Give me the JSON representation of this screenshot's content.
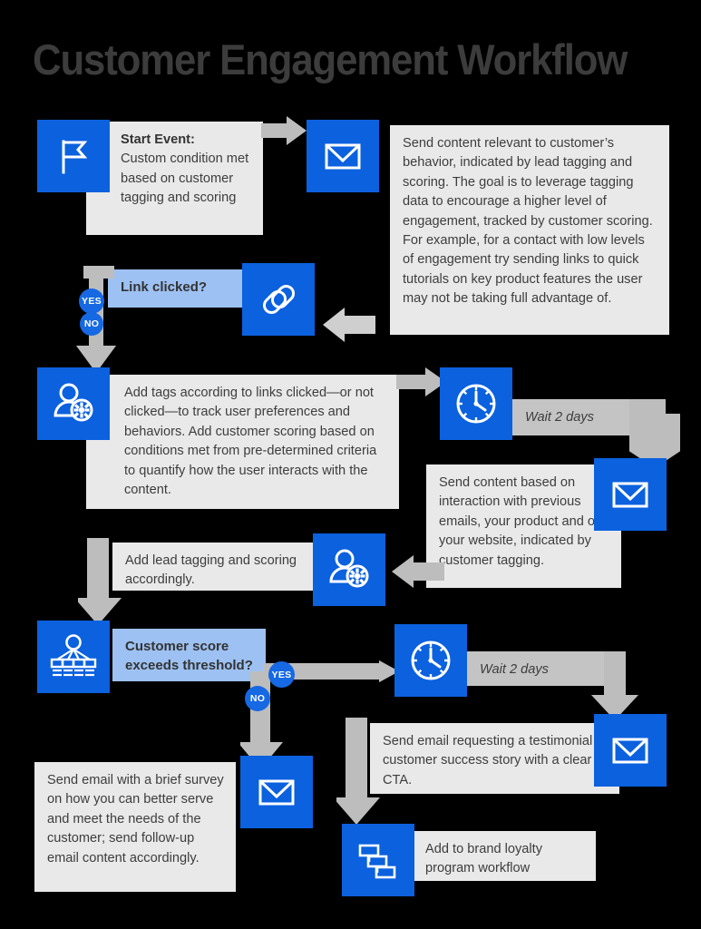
{
  "title": "Customer Engagement Workflow",
  "colors": {
    "background": "#000000",
    "icon_blue": "#0b61de",
    "decision_blue": "#9dc1f2",
    "text_gray": "#e9e9e9",
    "wait_gray": "#c4c4c4",
    "arrow_gray": "#bdbdbd",
    "badge_blue": "#1668e3",
    "title_gray": "#3c3c3c"
  },
  "badges": {
    "yes": "YES",
    "no": "NO"
  },
  "nodes": {
    "start_event": {
      "icon": "flag-icon",
      "heading": "Start Event:",
      "body": "Custom condition met based on customer tagging and scoring"
    },
    "send_content_behavior": {
      "icon": "envelope-icon",
      "body": "Send content relevant to customer’s behavior, indicated by lead tagging and scoring. The goal is to leverage tagging data to encourage a higher level of engagement, tracked by customer scoring. For example, for a contact with low levels of engagement try sending links to quick tutorials on key product features the user may not be taking full advantage of."
    },
    "link_clicked": {
      "icon": "link-icon",
      "label": "Link clicked?"
    },
    "add_tags": {
      "icon": "user-gear-icon",
      "body": "Add tags according to links clicked—or not clicked—to track user preferences and behaviors. Add customer scoring based on conditions met from pre-determined criteria to quantify how the user interacts with the content."
    },
    "wait_1": {
      "icon": "clock-icon",
      "label": "Wait 2 days"
    },
    "send_content_interaction": {
      "icon": "envelope-icon",
      "body": "Send content based on interaction with previous emails, your product and on your website, indicated by customer tagging."
    },
    "add_lead_tagging": {
      "icon": "user-gear-icon",
      "body": "Add lead tagging and scoring accordingly."
    },
    "customer_score": {
      "icon": "segmentation-icon",
      "label": "Customer score exceeds threshold?"
    },
    "wait_2": {
      "icon": "clock-icon",
      "label": "Wait 2 days"
    },
    "send_testimonial": {
      "icon": "envelope-icon",
      "body": "Send email requesting a testimonial or customer success story with a clear CTA."
    },
    "send_survey": {
      "icon": "envelope-icon",
      "body": "Send email with a brief survey on how you can better serve and meet the needs of the customer; send follow-up email content accordingly."
    },
    "brand_loyalty": {
      "icon": "workflow-icon",
      "body": "Add to brand loyalty program workflow"
    }
  }
}
